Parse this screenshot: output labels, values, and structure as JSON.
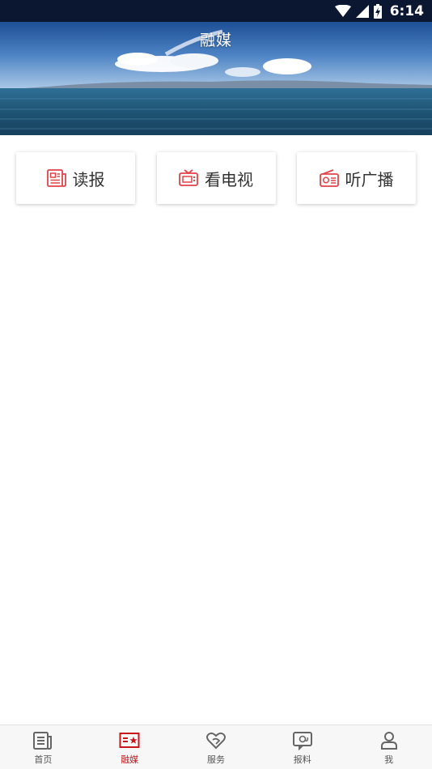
{
  "status_bar": {
    "time": "6:14"
  },
  "header": {
    "title": "融媒"
  },
  "media_cards": [
    {
      "label": "读报",
      "icon": "newspaper-icon"
    },
    {
      "label": "看电视",
      "icon": "tv-icon"
    },
    {
      "label": "听广播",
      "icon": "radio-icon"
    }
  ],
  "bottom_nav": [
    {
      "label": "首页",
      "icon": "news-icon",
      "active": false
    },
    {
      "label": "融媒",
      "icon": "media-star-icon",
      "active": true
    },
    {
      "label": "服务",
      "icon": "heart-service-icon",
      "active": false
    },
    {
      "label": "报料",
      "icon": "report-icon",
      "active": false
    },
    {
      "label": "我",
      "icon": "profile-icon",
      "active": false
    }
  ],
  "colors": {
    "accent": "#c8161d",
    "icon_red": "#e0434a",
    "nav_inactive": "#555555"
  }
}
